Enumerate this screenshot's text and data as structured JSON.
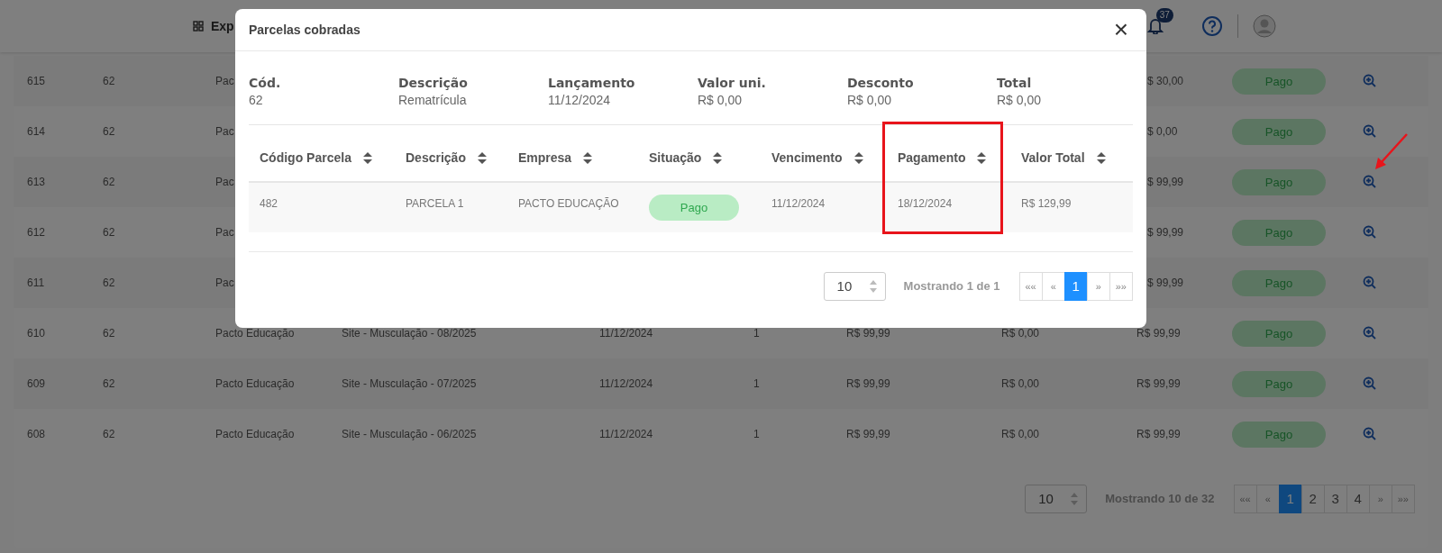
{
  "header": {
    "menu_label": "Exp",
    "notification_count": "37"
  },
  "table": {
    "rows": [
      {
        "id": "615",
        "client": "62",
        "company": "Pac",
        "total": "$ 30,00",
        "status": "Pago"
      },
      {
        "id": "614",
        "client": "62",
        "company": "Pac",
        "total": "$ 0,00",
        "status": "Pago"
      },
      {
        "id": "613",
        "client": "62",
        "company": "Pac",
        "total": "$ 99,99",
        "status": "Pago"
      },
      {
        "id": "612",
        "client": "62",
        "company": "Pac",
        "total": "$ 99,99",
        "status": "Pago"
      },
      {
        "id": "611",
        "client": "62",
        "company": "Pac",
        "total": "$ 99,99",
        "status": "Pago"
      },
      {
        "id": "610",
        "client": "62",
        "company": "Pacto Educação",
        "description": "Site - Musculação - 08/2025",
        "date": "11/12/2024",
        "quantity": "1",
        "value": "R$ 99,99",
        "discount": "R$ 0,00",
        "total": "R$ 99,99",
        "status": "Pago"
      },
      {
        "id": "609",
        "client": "62",
        "company": "Pacto Educação",
        "description": "Site - Musculação - 07/2025",
        "date": "11/12/2024",
        "quantity": "1",
        "value": "R$ 99,99",
        "discount": "R$ 0,00",
        "total": "R$ 99,99",
        "status": "Pago"
      },
      {
        "id": "608",
        "client": "62",
        "company": "Pacto Educação",
        "description": "Site - Musculação - 06/2025",
        "date": "11/12/2024",
        "quantity": "1",
        "value": "R$ 99,99",
        "discount": "R$ 0,00",
        "total": "R$ 99,99",
        "status": "Pago"
      }
    ],
    "pagination": {
      "page_size": "10",
      "info": "Mostrando 10 de 32",
      "first": "««",
      "prev": "«",
      "next": "»",
      "last": "»»",
      "pages": [
        {
          "label": "1",
          "selected": true
        },
        {
          "label": "2",
          "selected": false
        },
        {
          "label": "3",
          "selected": false
        },
        {
          "label": "4",
          "selected": false
        }
      ]
    }
  },
  "modal": {
    "title": "Parcelas cobradas",
    "close": "×",
    "summary": [
      {
        "label": "Cód.",
        "value": "62"
      },
      {
        "label": "Descrição",
        "value": "Rematrícula"
      },
      {
        "label": "Lançamento",
        "value": "11/12/2024"
      },
      {
        "label": "Valor uni.",
        "value": "R$ 0,00"
      },
      {
        "label": "Desconto",
        "value": "R$ 0,00"
      },
      {
        "label": "Total",
        "value": "R$ 0,00"
      }
    ],
    "columns": [
      "Código Parcela",
      "Descrição",
      "Empresa",
      "Situação",
      "Vencimento",
      "Pagamento",
      "Valor Total"
    ],
    "rows": [
      {
        "cells": [
          "482",
          "PARCELA 1",
          "PACTO EDUCAÇÃO",
          "Pago",
          "11/12/2024",
          "18/12/2024",
          "R$ 129,99"
        ]
      }
    ],
    "pagination": {
      "page_size": "10",
      "info": "Mostrando 1 de 1",
      "first": "««",
      "prev": "«",
      "next": "»",
      "last": "»»",
      "pages": [
        {
          "label": "1",
          "selected": true
        }
      ]
    }
  }
}
